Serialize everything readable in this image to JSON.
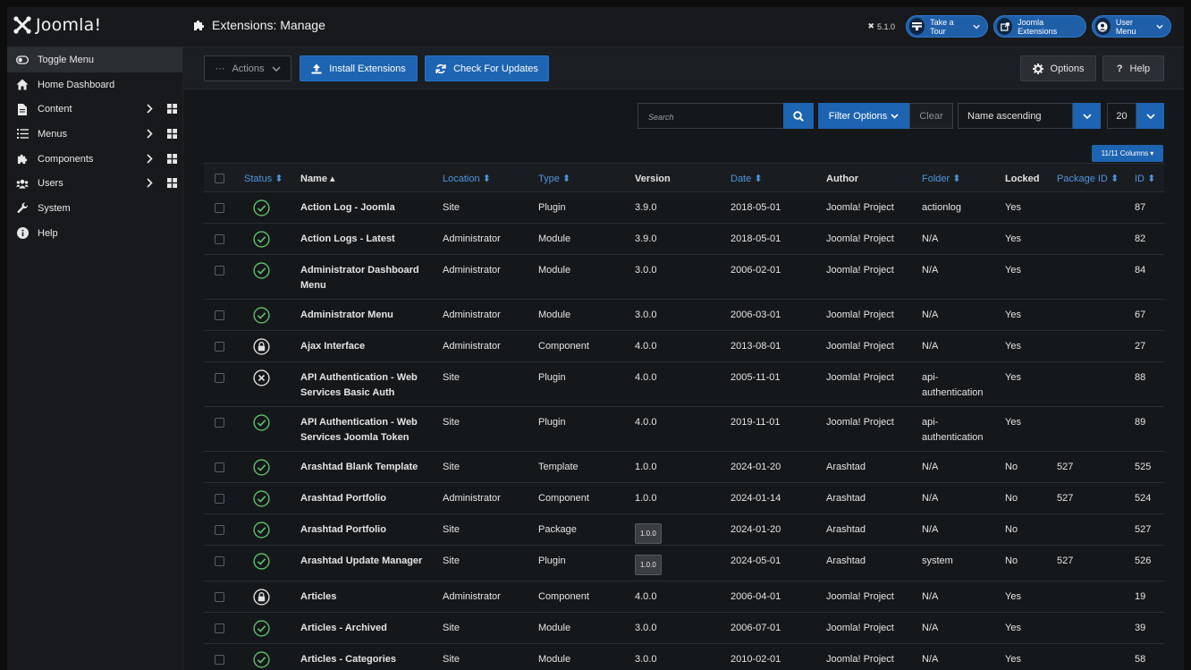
{
  "header": {
    "logo_text": "Joomla!",
    "page_title": "Extensions: Manage",
    "version": "5.1.0",
    "take_tour": "Take a Tour",
    "joomla_extensions": "Joomla Extensions",
    "user_menu": "User Menu"
  },
  "sidebar": {
    "items": [
      {
        "label": "Toggle Menu",
        "icon": "toggle-icon"
      },
      {
        "label": "Home Dashboard",
        "icon": "home-icon"
      },
      {
        "label": "Content",
        "icon": "file-icon"
      },
      {
        "label": "Menus",
        "icon": "list-icon"
      },
      {
        "label": "Components",
        "icon": "puzzle-icon"
      },
      {
        "label": "Users",
        "icon": "users-icon"
      },
      {
        "label": "System",
        "icon": "wrench-icon"
      },
      {
        "label": "Help",
        "icon": "info-icon"
      }
    ]
  },
  "toolbar": {
    "actions": "Actions",
    "install": "Install Extensions",
    "check_updates": "Check For Updates",
    "options": "Options",
    "help": "Help"
  },
  "filters": {
    "search_placeholder": "Search",
    "filter_options": "Filter Options",
    "clear": "Clear",
    "sort": "Name ascending",
    "limit": "20",
    "columns": "11/11 Columns"
  },
  "table": {
    "columns": [
      "Status",
      "Name",
      "Location",
      "Type",
      "Version",
      "Date",
      "Author",
      "Folder",
      "Locked",
      "Package ID",
      "ID"
    ],
    "rows": [
      {
        "status": "enabled",
        "name": "Action Log - Joomla",
        "location": "Site",
        "type": "Plugin",
        "version": "3.9.0",
        "version_badge": false,
        "date": "2018-05-01",
        "author": "Joomla! Project",
        "folder": "actionlog",
        "locked": "Yes",
        "package_id": "",
        "id": "87"
      },
      {
        "status": "enabled",
        "name": "Action Logs - Latest",
        "location": "Administrator",
        "type": "Module",
        "version": "3.9.0",
        "version_badge": false,
        "date": "2018-05-01",
        "author": "Joomla! Project",
        "folder": "N/A",
        "locked": "Yes",
        "package_id": "",
        "id": "82"
      },
      {
        "status": "enabled",
        "name": "Administrator Dashboard Menu",
        "location": "Administrator",
        "type": "Module",
        "version": "3.0.0",
        "version_badge": false,
        "date": "2006-02-01",
        "author": "Joomla! Project",
        "folder": "N/A",
        "locked": "Yes",
        "package_id": "",
        "id": "84"
      },
      {
        "status": "enabled",
        "name": "Administrator Menu",
        "location": "Administrator",
        "type": "Module",
        "version": "3.0.0",
        "version_badge": false,
        "date": "2006-03-01",
        "author": "Joomla! Project",
        "folder": "N/A",
        "locked": "Yes",
        "package_id": "",
        "id": "67"
      },
      {
        "status": "locked",
        "name": "Ajax Interface",
        "location": "Administrator",
        "type": "Component",
        "version": "4.0.0",
        "version_badge": false,
        "date": "2013-08-01",
        "author": "Joomla! Project",
        "folder": "N/A",
        "locked": "Yes",
        "package_id": "",
        "id": "27"
      },
      {
        "status": "disabled",
        "name": "API Authentication - Web Services Basic Auth",
        "location": "Site",
        "type": "Plugin",
        "version": "4.0.0",
        "version_badge": false,
        "date": "2005-11-01",
        "author": "Joomla! Project",
        "folder": "api-authentication",
        "locked": "Yes",
        "package_id": "",
        "id": "88"
      },
      {
        "status": "enabled",
        "name": "API Authentication - Web Services Joomla Token",
        "location": "Site",
        "type": "Plugin",
        "version": "4.0.0",
        "version_badge": false,
        "date": "2019-11-01",
        "author": "Joomla! Project",
        "folder": "api-authentication",
        "locked": "Yes",
        "package_id": "",
        "id": "89"
      },
      {
        "status": "enabled",
        "name": "Arashtad Blank Template",
        "location": "Site",
        "type": "Template",
        "version": "1.0.0",
        "version_badge": false,
        "date": "2024-01-20",
        "author": "Arashtad",
        "folder": "N/A",
        "locked": "No",
        "package_id": "527",
        "id": "525"
      },
      {
        "status": "enabled",
        "name": "Arashtad Portfolio",
        "location": "Administrator",
        "type": "Component",
        "version": "1.0.0",
        "version_badge": false,
        "date": "2024-01-14",
        "author": "Arashtad",
        "folder": "N/A",
        "locked": "No",
        "package_id": "527",
        "id": "524"
      },
      {
        "status": "enabled",
        "name": "Arashtad Portfolio",
        "location": "Site",
        "type": "Package",
        "version": "1.0.0",
        "version_badge": true,
        "date": "2024-01-20",
        "author": "Arashtad",
        "folder": "N/A",
        "locked": "No",
        "package_id": "",
        "id": "527"
      },
      {
        "status": "enabled",
        "name": "Arashtad Update Manager",
        "location": "Site",
        "type": "Plugin",
        "version": "1.0.0",
        "version_badge": true,
        "date": "2024-05-01",
        "author": "Arashtad",
        "folder": "system",
        "locked": "No",
        "package_id": "527",
        "id": "526"
      },
      {
        "status": "locked",
        "name": "Articles",
        "location": "Administrator",
        "type": "Component",
        "version": "4.0.0",
        "version_badge": false,
        "date": "2006-04-01",
        "author": "Joomla! Project",
        "folder": "N/A",
        "locked": "Yes",
        "package_id": "",
        "id": "19"
      },
      {
        "status": "enabled",
        "name": "Articles - Archived",
        "location": "Site",
        "type": "Module",
        "version": "3.0.0",
        "version_badge": false,
        "date": "2006-07-01",
        "author": "Joomla! Project",
        "folder": "N/A",
        "locked": "Yes",
        "package_id": "",
        "id": "39"
      },
      {
        "status": "enabled",
        "name": "Articles - Categories",
        "location": "Site",
        "type": "Module",
        "version": "3.0.0",
        "version_badge": false,
        "date": "2010-02-01",
        "author": "Joomla! Project",
        "folder": "N/A",
        "locked": "Yes",
        "package_id": "",
        "id": "58"
      }
    ]
  },
  "colors": {
    "accent": "#1d64b2",
    "link": "#4f94e0",
    "status_ok": "#5ec26a",
    "bg": "#15181b"
  }
}
